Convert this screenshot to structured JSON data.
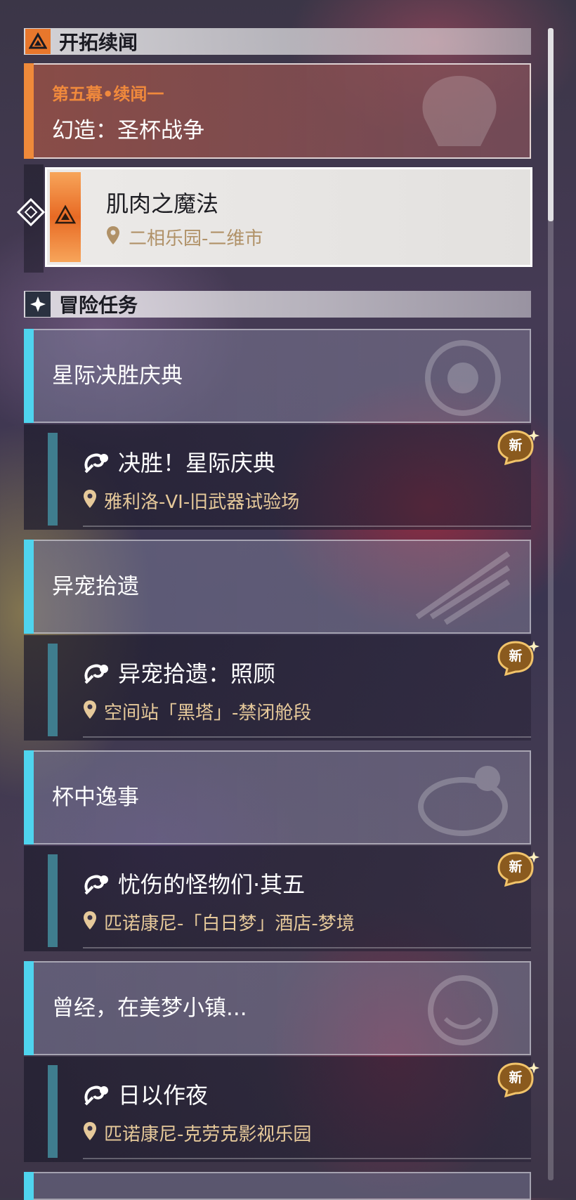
{
  "colors": {
    "accent_orange": "#ef8a3a",
    "accent_cyan": "#4fd4ee",
    "location_gold": "#e6c99a"
  },
  "trailblaze": {
    "header": "开拓续闻",
    "chapter": "第五幕•续闻一",
    "title": "幻造：圣杯战争",
    "quest": {
      "title": "肌肉之魔法",
      "location": "二相乐园-二维市"
    }
  },
  "adventure": {
    "header": "冒险任务",
    "categories": [
      {
        "title": "星际决胜庆典",
        "quest": {
          "title": "决胜！星际庆典",
          "location": "雅利洛-VI-旧武器试验场",
          "badge": "新"
        }
      },
      {
        "title": "异宠拾遗",
        "quest": {
          "title": "异宠拾遗：照顾",
          "location": "空间站「黑塔」-禁闭舱段",
          "badge": "新"
        }
      },
      {
        "title": "杯中逸事",
        "quest": {
          "title": "忧伤的怪物们·其五",
          "location": "匹诺康尼-「白日梦」酒店-梦境",
          "badge": "新"
        }
      },
      {
        "title": "曾经，在美梦小镇...",
        "quest": {
          "title": "日以作夜",
          "location": "匹诺康尼-克劳克影视乐园",
          "badge": "新"
        }
      }
    ]
  }
}
